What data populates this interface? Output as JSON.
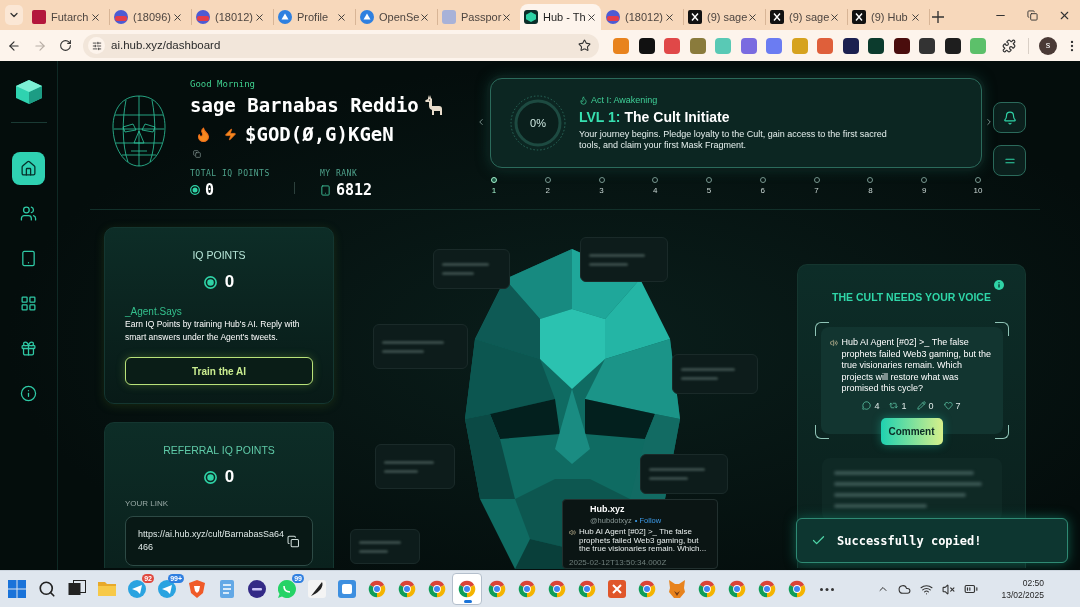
{
  "browser": {
    "tabs": [
      {
        "title": "Futarch",
        "selected": false
      },
      {
        "title": "(18096)",
        "selected": false
      },
      {
        "title": "(18012)",
        "selected": false
      },
      {
        "title": "Profile",
        "selected": false
      },
      {
        "title": "OpenSe",
        "selected": false
      },
      {
        "title": "Passpor",
        "selected": false
      },
      {
        "title": "Hub - Th",
        "selected": true
      },
      {
        "title": "(18012)",
        "selected": false
      },
      {
        "title": "(9) sage",
        "selected": false
      },
      {
        "title": "(9) sage",
        "selected": false
      },
      {
        "title": "(9) Hub",
        "selected": false
      }
    ],
    "address": "ai.hub.xyz/dashboard",
    "profile_initial": "s"
  },
  "sidebar": {
    "items": [
      {
        "selected": true
      },
      {
        "selected": false
      },
      {
        "selected": false
      },
      {
        "selected": false
      },
      {
        "selected": false
      },
      {
        "selected": false
      }
    ]
  },
  "header": {
    "greeting": "Good Morning",
    "name": "sage Barnabas Reddio",
    "tag": "$GOD(Ø,G)KGeN",
    "stats": [
      {
        "label": "TOTAL IQ POINTS",
        "value": "0"
      },
      {
        "label": "MY RANK",
        "value": "6812"
      }
    ]
  },
  "level_banner": {
    "act": "Act I: Awakening",
    "level_label": "LVL 1:",
    "title": "The Cult Initiate",
    "description": "Your journey begins. Pledge loyalty to the Cult, gain access to the first sacred tools, and claim your first Mask Fragment.",
    "progress": {
      "level": 0,
      "reading": "0%"
    },
    "steps": [
      {
        "label": "1",
        "active": true
      },
      {
        "label": "2",
        "active": false
      },
      {
        "label": "3",
        "active": false
      },
      {
        "label": "4",
        "active": false
      },
      {
        "label": "5",
        "active": false
      },
      {
        "label": "6",
        "active": false
      },
      {
        "label": "7",
        "active": false
      },
      {
        "label": "8",
        "active": false
      },
      {
        "label": "9",
        "active": false
      },
      {
        "label": "10",
        "active": false
      }
    ]
  },
  "iq_card": {
    "title": "IQ POINTS",
    "value": "0",
    "agent_label": "_Agent.Says",
    "text": "Earn IQ Points by training Hub's AI. Reply with smart answers under the Agent's tweets.",
    "button": "Train the AI"
  },
  "referral_card": {
    "title": "REFERRAL IQ POINTS",
    "value": "0",
    "link_label": "YOUR LINK",
    "link": "https://ai.hub.xyz/cult/BarnabasSa64466"
  },
  "tweet_popup": {
    "author": "Hub.xyz",
    "handle": "@hubdotxyz",
    "follow": "• Follow",
    "text": "Hub AI Agent [#02] >_ The false prophets failed Web3 gaming, but the true visionaries remain. Which...",
    "timestamp": "2025-02-12T13:50:34.000Z"
  },
  "voice_card": {
    "title": "THE CULT NEEDS YOUR VOICE",
    "tweet": "Hub AI Agent [#02] >_ The false prophets failed Web3 gaming, but the true visionaries remain. Which projects will restore what was promised this cycle?",
    "stats": [
      {
        "count": "4"
      },
      {
        "count": "1"
      },
      {
        "count": "0"
      },
      {
        "count": "7"
      }
    ],
    "button": "Comment"
  },
  "toast": {
    "message": "Successfully copied!"
  },
  "taskbar": {
    "apps": [
      {
        "kind": "start",
        "selected": false
      },
      {
        "kind": "search",
        "selected": false
      },
      {
        "kind": "taskview",
        "selected": false
      },
      {
        "kind": "folder",
        "selected": false
      },
      {
        "kind": "plane",
        "selected": false,
        "badge": {
          "text": "92",
          "color": "#e0483e"
        }
      },
      {
        "kind": "plane",
        "selected": false,
        "badge": {
          "text": "99+",
          "color": "#2f7fe0"
        }
      },
      {
        "kind": "shield",
        "selected": false
      },
      {
        "kind": "notepad",
        "selected": false
      },
      {
        "kind": "round",
        "selected": false
      },
      {
        "kind": "chat",
        "selected": false,
        "badge": {
          "text": "99",
          "color": "#2f7fe0"
        }
      },
      {
        "kind": "quill",
        "selected": false
      },
      {
        "kind": "square",
        "selected": false
      },
      {
        "kind": "browser",
        "selected": false
      },
      {
        "kind": "browser",
        "selected": false
      },
      {
        "kind": "browser",
        "selected": false
      },
      {
        "kind": "browser",
        "selected": true
      },
      {
        "kind": "browser",
        "selected": false
      },
      {
        "kind": "browser",
        "selected": false
      },
      {
        "kind": "browser",
        "selected": false
      },
      {
        "kind": "browser",
        "selected": false
      },
      {
        "kind": "cross",
        "selected": false
      },
      {
        "kind": "browser",
        "selected": false
      },
      {
        "kind": "fox",
        "selected": false
      },
      {
        "kind": "browser",
        "selected": false
      },
      {
        "kind": "browser",
        "selected": false
      },
      {
        "kind": "browser",
        "selected": false
      },
      {
        "kind": "browser",
        "selected": false
      },
      {
        "kind": "more",
        "selected": false
      }
    ],
    "time": "02:50",
    "date": "13/02/2025"
  }
}
